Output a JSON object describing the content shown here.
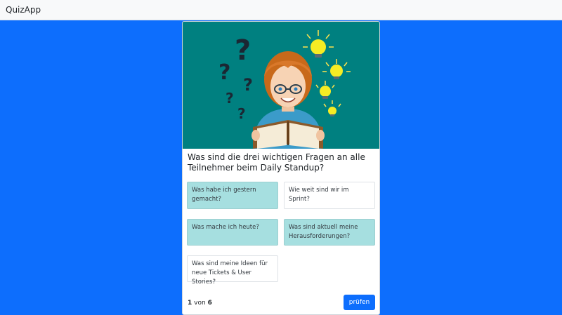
{
  "app": {
    "title": "QuizApp"
  },
  "quiz": {
    "question": "Was sind die drei wichtigen Fragen an alle Teilnehmer beim Daily Standup?",
    "answers": [
      {
        "label": "Was habe ich gestern gemacht?",
        "selected": true
      },
      {
        "label": "Wie weit sind wir im Sprint?",
        "selected": false
      },
      {
        "label": "Was mache ich heute?",
        "selected": true
      },
      {
        "label": "Was sind aktuell meine Herausforderungen?",
        "selected": true
      },
      {
        "label": "Was sind meine Ideen für neue Tickets & User Stories?",
        "selected": false
      }
    ],
    "progress": {
      "current": "1",
      "separator": "von",
      "total": "6"
    },
    "submit_label": "prüfen"
  },
  "colors": {
    "page_bg": "#0d6efd",
    "selected_answer": "#a6dfe0",
    "illustration_bg": "#008080",
    "button": "#0d6efd"
  }
}
